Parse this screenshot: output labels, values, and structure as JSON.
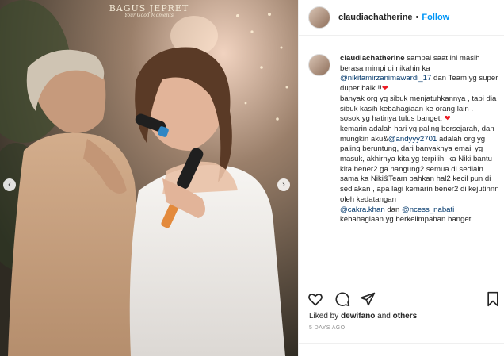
{
  "photo": {
    "watermark_title": "BAGUS JEPRET",
    "watermark_sub": "Your Good Moments",
    "prev_icon": "chevron-left-icon",
    "next_icon": "chevron-right-icon"
  },
  "header": {
    "username": "claudiachatherine",
    "separator": "•",
    "follow_label": "Follow"
  },
  "caption": {
    "username": "claudiachatherine",
    "segments": [
      {
        "t": " sampai saat ini masih berasa mimpi di nikahin ka ",
        "k": "text"
      },
      {
        "t": "@nikitamirzanimawardi_17",
        "k": "mention"
      },
      {
        "t": " dan Team yg super duper baik !!",
        "k": "text"
      },
      {
        "t": "❤",
        "k": "heart"
      },
      {
        "t": "\nbanyak org yg sibuk menjatuhkannya , tapi dia sibuk kasih kebahagiaan ke orang lain .\nsosok yg hatinya tulus banget, ",
        "k": "text"
      },
      {
        "t": "❤",
        "k": "heart"
      },
      {
        "t": "\nkemarin adalah hari yg paling bersejarah, dan mungkin aku&",
        "k": "text"
      },
      {
        "t": "@andyyy2701",
        "k": "mention"
      },
      {
        "t": " adalah org yg paling beruntung, dari banyaknya email yg masuk, akhirnya kita yg terpilih, ka Niki bantu kita bener2 ga nangung2 semua di sediain sama ka Niki&Team bahkan hal2 kecil pun di sediakan , apa lagi kemarin bener2 di kejutinnn oleh kedatangan\n",
        "k": "text"
      },
      {
        "t": "@cakra.khan",
        "k": "mention"
      },
      {
        "t": " dan ",
        "k": "text"
      },
      {
        "t": "@ncess_nabati",
        "k": "mention"
      },
      {
        "t": "\nkebahagiaan yg berkelimpahan banget",
        "k": "text"
      }
    ]
  },
  "actions": {
    "icons": [
      "heart-icon",
      "comment-icon",
      "share-icon",
      "bookmark-icon"
    ]
  },
  "likes": {
    "prefix": "Liked by ",
    "user": "dewifano",
    "middle": " and ",
    "others": "others"
  },
  "timestamp": "5 DAYS AGO",
  "colors": {
    "follow": "#0095f6",
    "mention": "#00376b",
    "heart": "#ed1c24",
    "muted": "#8e8e8e"
  }
}
